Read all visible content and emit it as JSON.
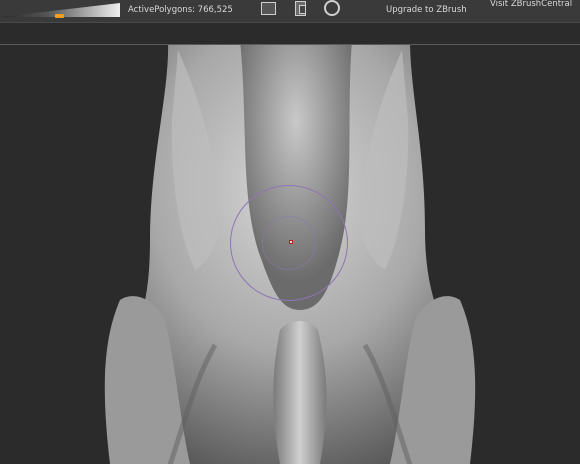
{
  "toolbar": {
    "active_polygons_label": "ActivePolygons: 766,525",
    "upgrade_label": "Upgrade to ZBrush",
    "visit_label": "Visit ZBrushCentral",
    "draw_size_level": 0.48
  },
  "icons": {
    "left": "frame-icon",
    "middle": "document-icon",
    "right": "rotate-icon"
  },
  "colors": {
    "accent": "#f0a020",
    "brush_ring": "#8d76b4",
    "brush_center": "#c02020",
    "background": "#2b2b2b"
  }
}
